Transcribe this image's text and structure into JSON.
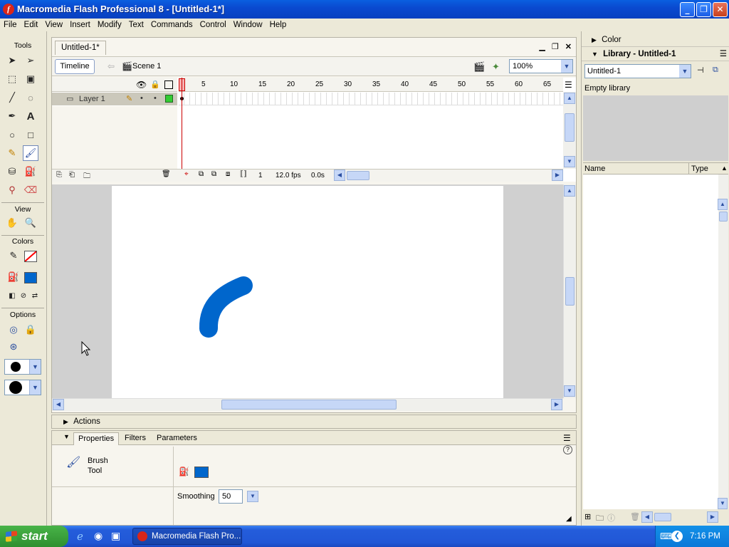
{
  "window": {
    "title": "Macromedia Flash Professional 8 - [Untitled-1*]",
    "app_icon_letter": "f"
  },
  "menu": [
    "File",
    "Edit",
    "View",
    "Insert",
    "Modify",
    "Text",
    "Commands",
    "Control",
    "Window",
    "Help"
  ],
  "tools": {
    "header": "Tools",
    "view_label": "View",
    "colors_label": "Colors",
    "options_label": "Options",
    "stroke_color": "#ff0000",
    "fill_color": "#0066cc"
  },
  "document": {
    "tab": "Untitled-1*",
    "timeline_button": "Timeline",
    "scene": "Scene 1",
    "zoom": "100%"
  },
  "timeline": {
    "layer_name": "Layer 1",
    "frame_numbers": [
      "1",
      "5",
      "10",
      "15",
      "20",
      "25",
      "30",
      "35",
      "40",
      "45",
      "50",
      "55",
      "60",
      "65"
    ],
    "current_frame": "1",
    "fps": "12.0 fps",
    "time": "0.0s"
  },
  "stage": {
    "stroke_color": "#0066cc"
  },
  "panels": {
    "actions": "Actions",
    "tabs": [
      "Properties",
      "Filters",
      "Parameters"
    ],
    "tool_name_line1": "Brush",
    "tool_name_line2": "Tool",
    "smoothing_label": "Smoothing",
    "smoothing_value": "50"
  },
  "right": {
    "color_header": "Color",
    "library_header": "Library - Untitled-1",
    "library_select": "Untitled-1",
    "empty_library": "Empty library",
    "col_name": "Name",
    "col_type": "Type"
  },
  "taskbar": {
    "start": "start",
    "app_button": "Macromedia Flash Pro...",
    "clock": "7:16 PM"
  }
}
